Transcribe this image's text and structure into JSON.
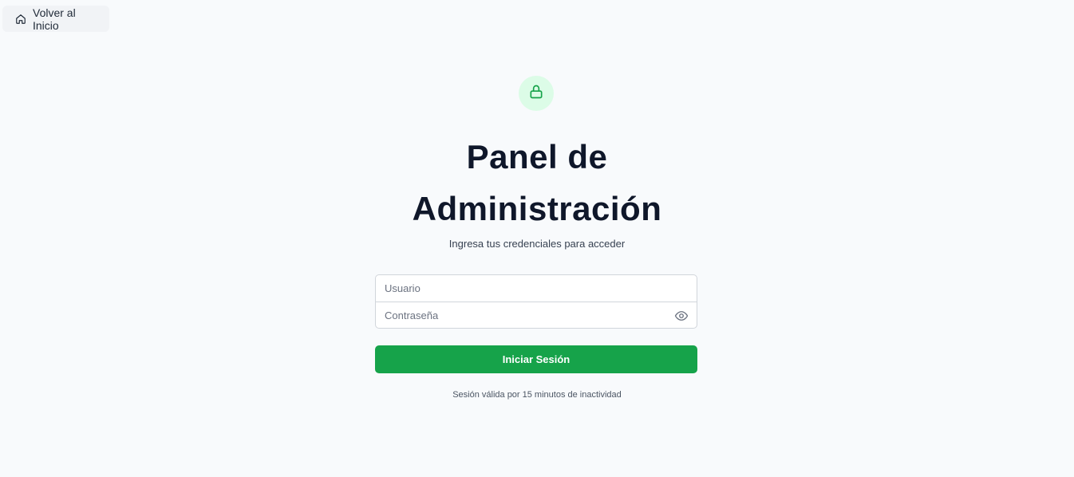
{
  "nav": {
    "back_label": "Volver al Inicio",
    "back_icon": "home-icon"
  },
  "header": {
    "lock_icon": "lock-icon",
    "title": "Panel de Administración",
    "subtitle": "Ingresa tus credenciales para acceder"
  },
  "form": {
    "username": {
      "placeholder": "Usuario",
      "value": ""
    },
    "password": {
      "placeholder": "Contraseña",
      "value": "",
      "toggle_icon": "eye-icon"
    },
    "submit_label": "Iniciar Sesión"
  },
  "footer": {
    "note": "Sesión válida por 15 minutos de inactividad"
  },
  "colors": {
    "accent": "#16a34a",
    "accent_light": "#dcfce7",
    "background": "#f8fafc",
    "title": "#0f172a"
  }
}
